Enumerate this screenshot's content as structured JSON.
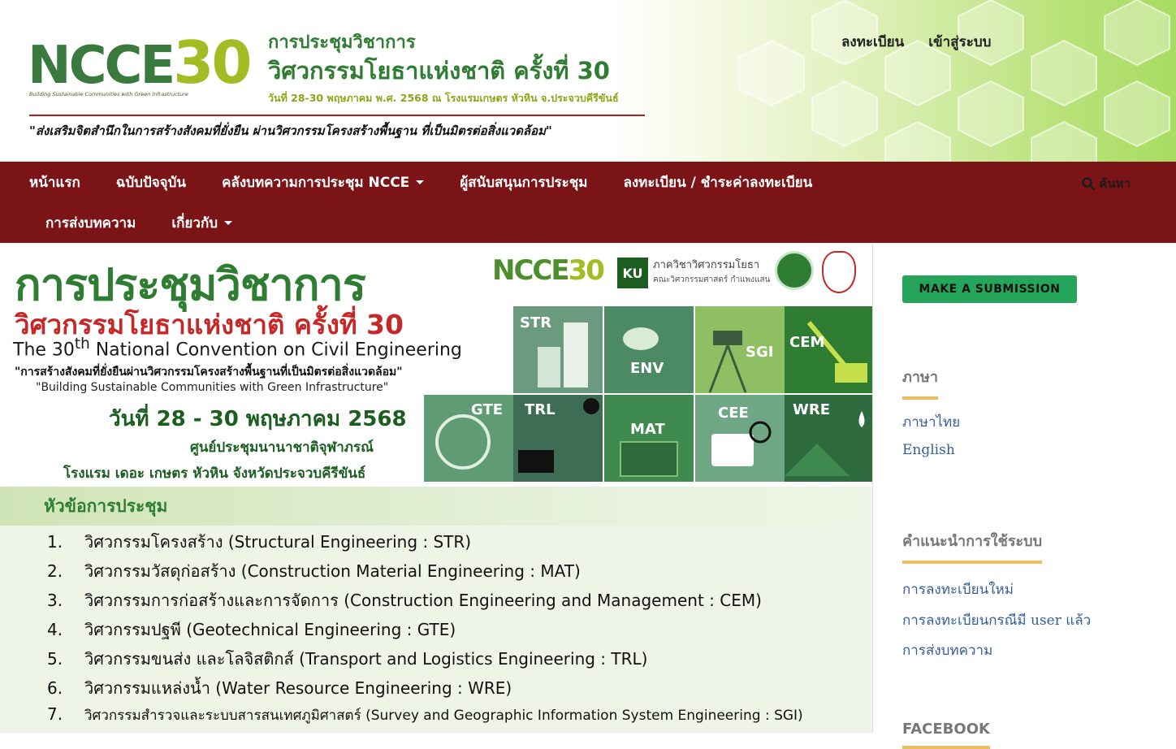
{
  "header": {
    "logo_text": "NCCE",
    "logo_number": "30",
    "logo_tagline": "Building Sustainable Communities with Green Infrastructure",
    "conf_title_line1": "การประชุมวิชาการ",
    "conf_title_line2": "วิศวกรรมโยธาแห่งชาติ ครั้งที่ 30",
    "conf_date_venue": "วันที่ 28-30 พฤษภาคม พ.ศ. 2568 ณ โรงแรมเกษตร หัวหิน  จ.ประจวบคีรีขันธ์",
    "slogan": "\"ส่งเสริมจิตสำนึกในการสร้างสังคมที่ยั่งยืน ผ่านวิศวกรรมโครงสร้างพื้นฐาน ที่เป็นมิตรต่อสิ่งแวดล้อม\"",
    "register_link": "ลงทะเบียน",
    "login_link": "เข้าสู่ระบบ"
  },
  "nav": {
    "row1": [
      {
        "label": "หน้าแรก",
        "dropdown": false
      },
      {
        "label": "ฉบับปัจจุบัน",
        "dropdown": false
      },
      {
        "label": "คลังบทความการประชุม NCCE",
        "dropdown": true
      },
      {
        "label": "ผู้สนับสนุนการประชุม",
        "dropdown": false
      },
      {
        "label": "ลงทะเบียน / ชำระค่าลงทะเบียน",
        "dropdown": false
      }
    ],
    "row2": [
      {
        "label": "การส่งบทความ",
        "dropdown": false
      },
      {
        "label": "เกี่ยวกับ",
        "dropdown": true
      }
    ],
    "search_label": "ค้นหา"
  },
  "banner": {
    "title1": "การประชุมวิชาการ",
    "title2": "วิศวกรรมโยธาแห่งชาติ ครั้งที่ 30",
    "title3_prefix": "The 30",
    "title3_sup": "th",
    "title3_suffix": " National Convention on Civil Engineering",
    "slogan_th": "\"การสร้างสังคมที่ยั่งยืนผ่านวิศวกรรมโครงสร้างพื้นฐานที่เป็นมิตรต่อสิ่งแวดล้อม\"",
    "slogan_en": "\"Building Sustainable Communities with Green Infrastructure\"",
    "date": "วันที่ 28 - 30 พฤษภาคม 2568",
    "venue1": "ศูนย์ประชุมนานาชาติจุฬาภรณ์",
    "venue2": "โรงแรม เดอะ เกษตร หัวหิน จังหวัดประจวบคีรีขันธ์",
    "small_logo_text": "NCCE",
    "small_logo_number": "30",
    "ku_abbr": "KU",
    "ku_department": "ภาควิชาวิศวกรรมโยธา",
    "ku_faculty": "คณะวิศวกรรมศาสตร์ กำแพงแสน",
    "tiles": [
      {
        "label": "STR",
        "color": "#6b9a7e"
      },
      {
        "label": "ENV",
        "color": "#4b8a62"
      },
      {
        "label": "SGI",
        "color": "#8fbf63"
      },
      {
        "label": "CEM",
        "color": "#2e7d32"
      },
      {
        "label": "GTE",
        "color": "#5f9c73"
      },
      {
        "label": "TRL",
        "color": "#3d6e55"
      },
      {
        "label": "MAT",
        "color": "#3f8b4f"
      },
      {
        "label": "CEE",
        "color": "#6fa684"
      },
      {
        "label": "WRE",
        "color": "#2e6b3f"
      }
    ],
    "topics_title": "หัวข้อการประชุม",
    "topics": [
      {
        "num": "1.",
        "text": "วิศวกรรมโครงสร้าง (Structural Engineering : STR)"
      },
      {
        "num": "2.",
        "text": "วิศวกรรมวัสดุก่อสร้าง (Construction Material Engineering : MAT)"
      },
      {
        "num": "3.",
        "text": "วิศวกรรมการก่อสร้างและการจัดการ (Construction Engineering and Management : CEM)"
      },
      {
        "num": "4.",
        "text": "วิศวกรรมปฐพี (Geotechnical Engineering : GTE)"
      },
      {
        "num": "5.",
        "text": "วิศวกรรมขนส่ง และโลจิสติกส์ (Transport and Logistics Engineering : TRL)"
      },
      {
        "num": "6.",
        "text": "วิศวกรรมแหล่งน้ำ (Water Resource Engineering : WRE)"
      },
      {
        "num": "7.",
        "text": "วิศวกรรมสำรวจและระบบสารสนเทศภูมิศาสตร์ (Survey and Geographic Information System Engineering : SGI)"
      }
    ]
  },
  "sidebar": {
    "submit_button": "MAKE A SUBMISSION",
    "language_heading": "ภาษา",
    "languages": [
      "ภาษาไทย",
      "English"
    ],
    "guide_heading": "คำแนะนำการใช้ระบบ",
    "guide_links": [
      "การลงทะเบียนใหม่",
      "การลงทะเบียนกรณีมี user แล้ว",
      "การส่งบทความ"
    ],
    "facebook_heading": "FACEBOOK"
  },
  "colors": {
    "nav_bg": "#7b1416",
    "brand_green": "#2e7d32",
    "submit_green": "#24a55a",
    "link_blue": "#355f9a",
    "heading_underline": "#e8c063"
  }
}
